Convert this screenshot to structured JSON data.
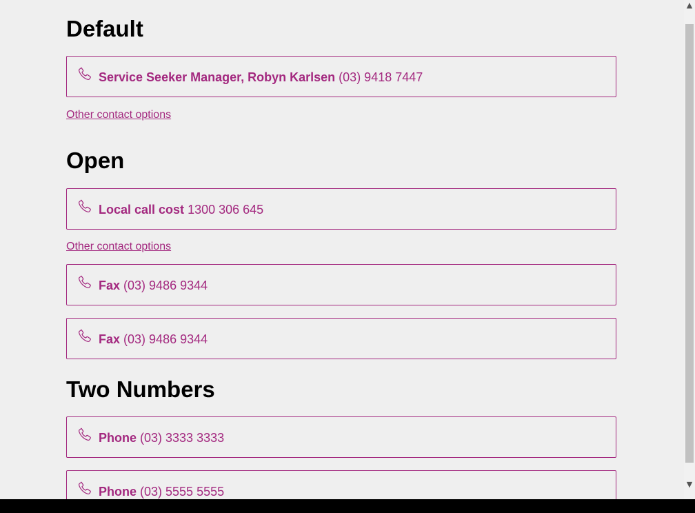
{
  "sections": [
    {
      "title": "Default",
      "contacts": [
        {
          "label": "Service Seeker Manager, Robyn Karlsen",
          "number": " (03) 9418 7447"
        }
      ],
      "other_link": "Other contact options"
    },
    {
      "title": "Open",
      "contacts": [
        {
          "label": "Local call cost",
          "number": " 1300 306 645"
        },
        {
          "label": "Fax",
          "number": " (03) 9486 9344"
        },
        {
          "label": "Fax",
          "number": " (03) 9486 9344"
        }
      ],
      "other_link": "Other contact options"
    },
    {
      "title": "Two Numbers",
      "contacts": [
        {
          "label": "Phone",
          "number": " (03) 3333 3333"
        },
        {
          "label": "Phone",
          "number": " (03) 5555 5555"
        }
      ]
    }
  ],
  "colors": {
    "accent": "#a3287f",
    "background": "#efefef",
    "heading": "#000000"
  },
  "icons": {
    "contact": "phone-icon",
    "scroll_up": "scroll-up-arrow-icon",
    "scroll_down": "scroll-down-arrow-icon"
  }
}
